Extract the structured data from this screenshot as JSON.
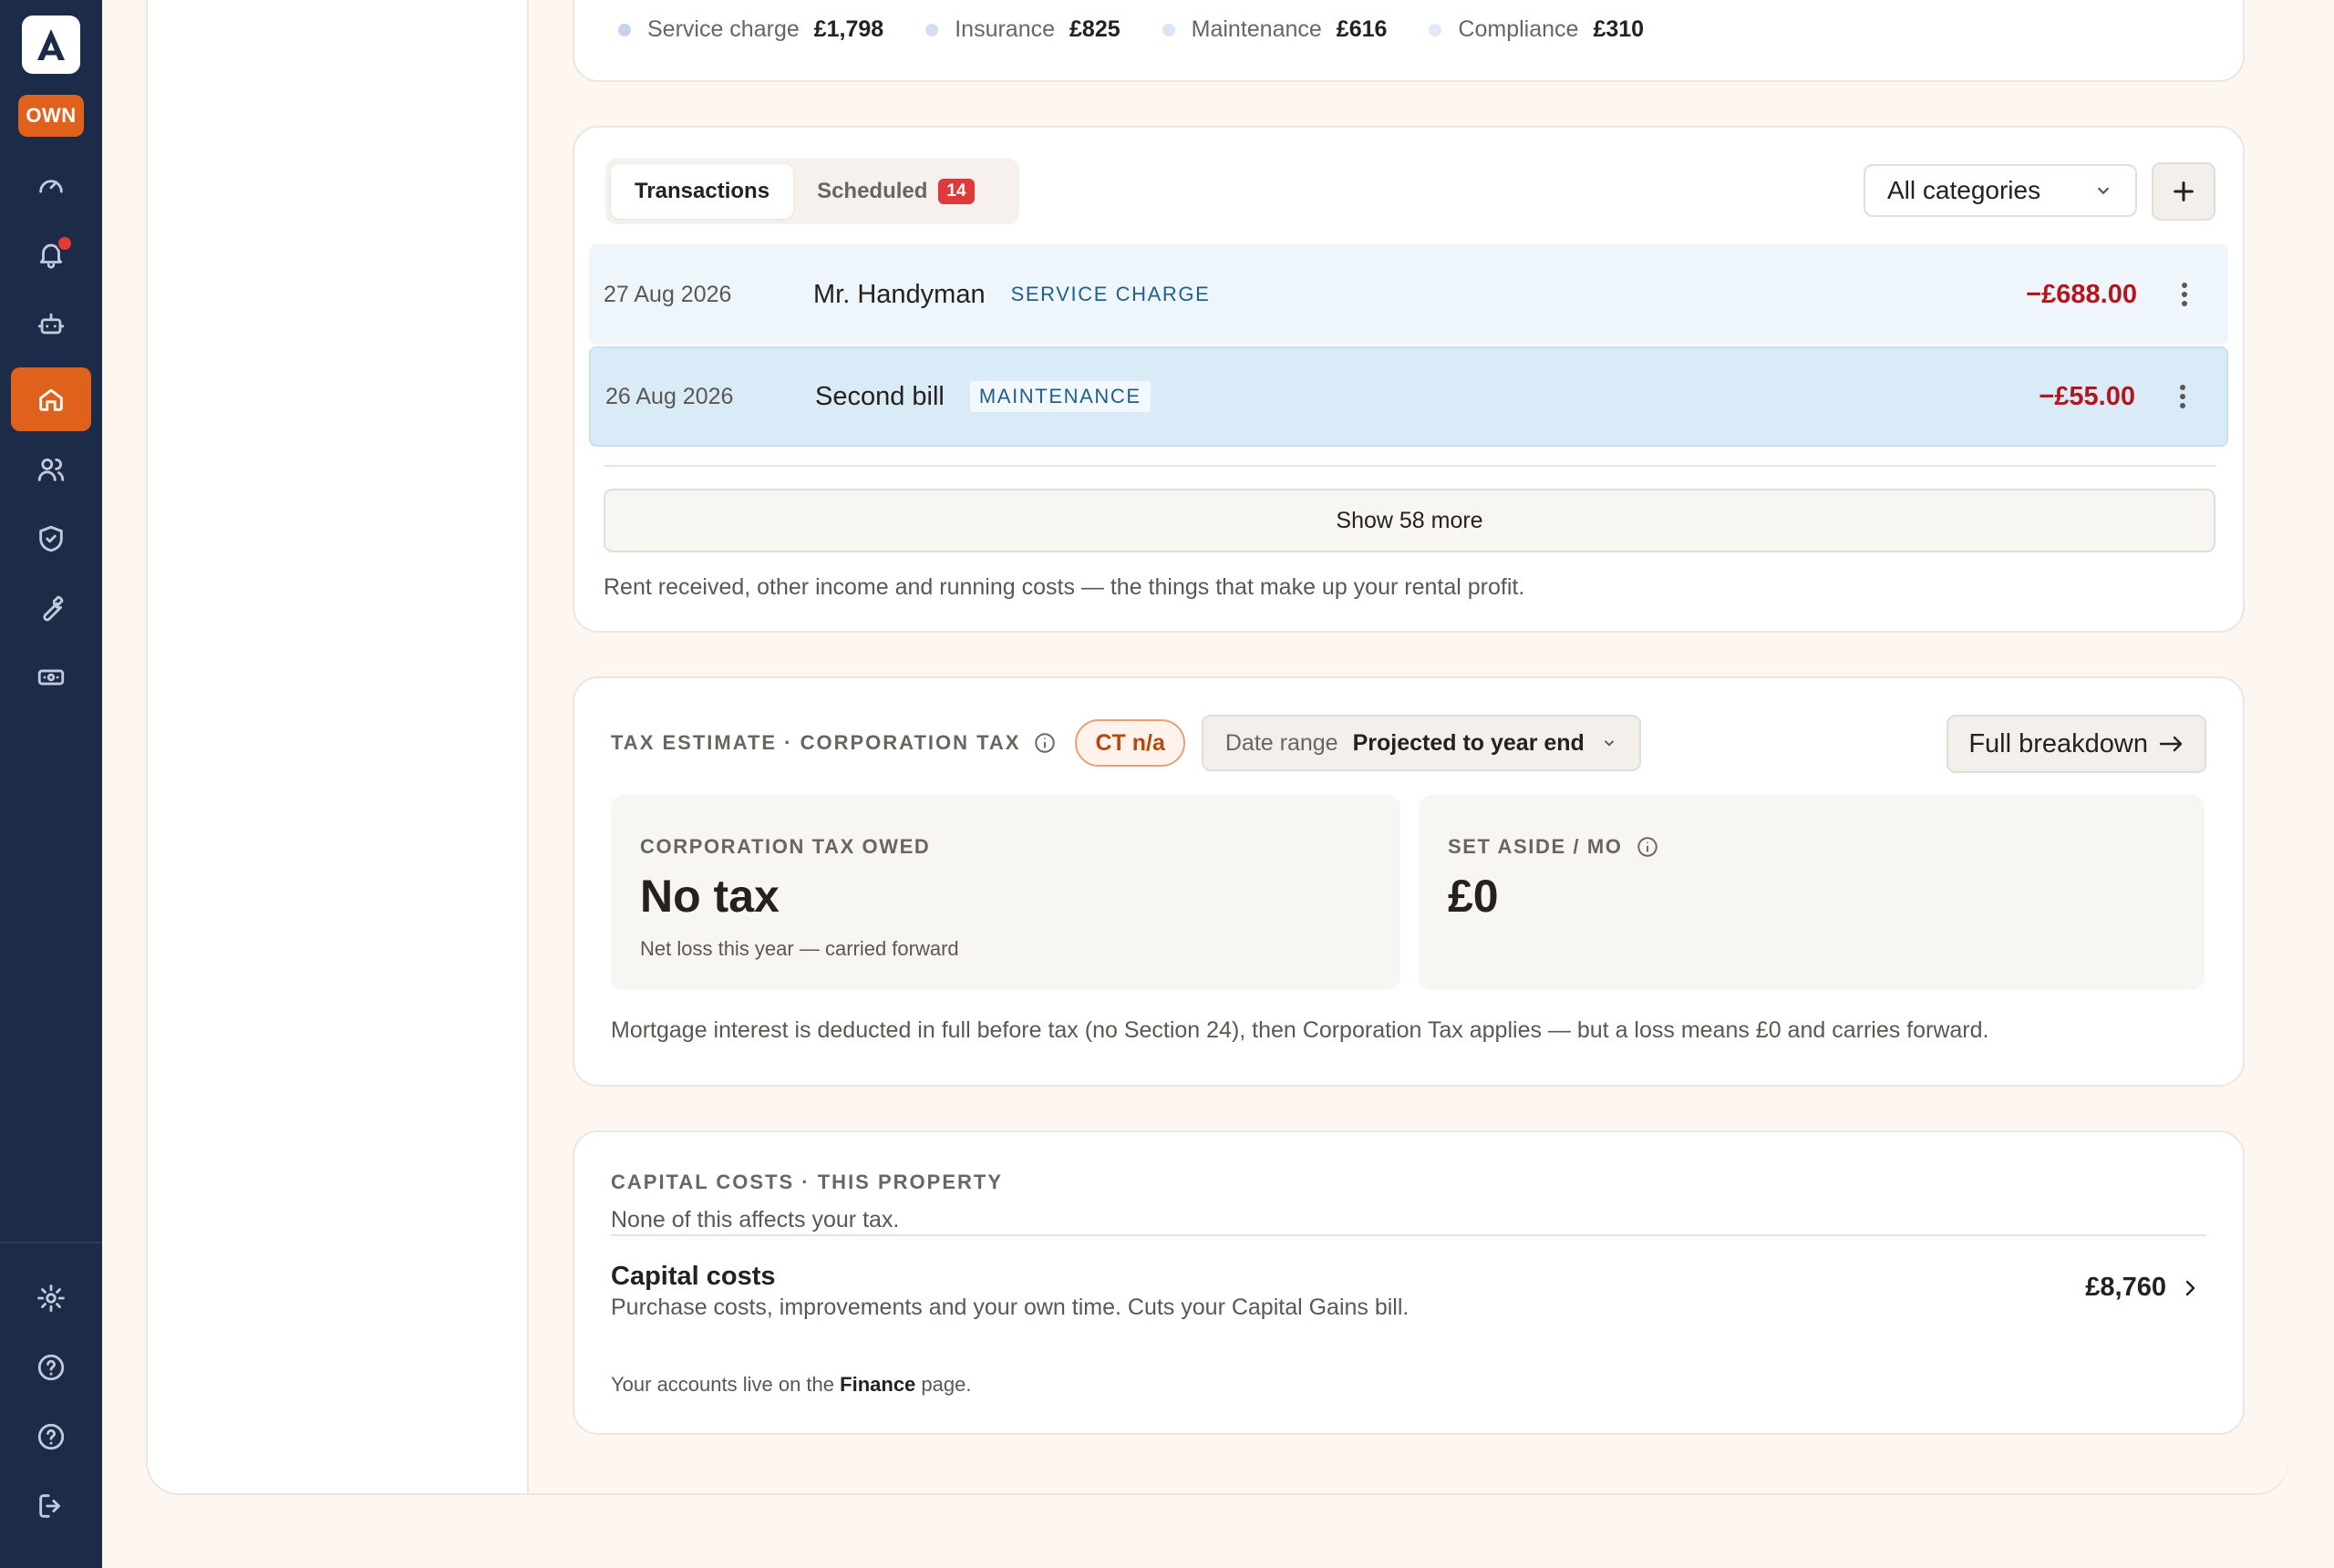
{
  "app": {
    "brand_badge": "OWN",
    "colors": {
      "accent": "#e0611c",
      "rail": "#1c2b48",
      "negative": "#b3161d",
      "tag": "#1f5f8b"
    }
  },
  "nav": {
    "items": [
      {
        "icon": "gauge-icon",
        "active": false
      },
      {
        "icon": "bell-icon",
        "active": false,
        "has_notification": true
      },
      {
        "icon": "bot-icon",
        "active": false
      },
      {
        "icon": "home-icon",
        "active": true
      },
      {
        "icon": "users-icon",
        "active": false
      },
      {
        "icon": "shield-check-icon",
        "active": false
      },
      {
        "icon": "wrench-icon",
        "active": false
      },
      {
        "icon": "banknote-icon",
        "active": false
      }
    ],
    "bottom": [
      {
        "icon": "settings-icon"
      },
      {
        "icon": "help-circle-icon"
      },
      {
        "icon": "help-circle-icon"
      },
      {
        "icon": "logout-icon"
      }
    ]
  },
  "summary": {
    "items": [
      {
        "label": "Service charge",
        "value": "£1,798",
        "color": "#c7d3e6"
      },
      {
        "label": "Insurance",
        "value": "£825",
        "color": "#d3def0"
      },
      {
        "label": "Maintenance",
        "value": "£616",
        "color": "#dbe5f3"
      },
      {
        "label": "Compliance",
        "value": "£310",
        "color": "#e1e9f5"
      }
    ]
  },
  "transactions": {
    "tabs": [
      {
        "label": "Transactions",
        "active": true
      },
      {
        "label": "Scheduled",
        "count": "14"
      }
    ],
    "category_filter": "All categories",
    "rows": [
      {
        "date": "27 Aug 2026",
        "payee": "Mr. Handyman",
        "tag": "SERVICE CHARGE",
        "amount": "−£688.00"
      },
      {
        "date": "26 Aug 2026",
        "payee": "Second bill",
        "tag": "MAINTENANCE",
        "amount": "−£55.00"
      }
    ],
    "show_more": "Show 58 more",
    "caption": "Rent received, other income and running costs — the things that make up your rental profit."
  },
  "tax": {
    "eyebrow": "TAX ESTIMATE · CORPORATION TAX",
    "ct_pill": "CT n/a",
    "date_range_label": "Date range",
    "date_range_value": "Projected to year end",
    "breakdown_button": "Full breakdown",
    "owed": {
      "label": "CORPORATION TAX OWED",
      "value": "No tax",
      "sub": "Net loss this year — carried forward"
    },
    "set_aside": {
      "label": "SET ASIDE / MO",
      "value": "£0"
    },
    "caption": "Mortgage interest is deducted in full before tax (no Section 24), then Corporation Tax applies — but a loss means £0 and carries forward."
  },
  "capital": {
    "eyebrow": "CAPITAL COSTS · THIS PROPERTY",
    "sub": "None of this affects your tax.",
    "title": "Capital costs",
    "description": "Purchase costs, improvements and your own time. Cuts your Capital Gains bill.",
    "amount": "£8,760",
    "footer_prefix": "Your accounts live on the",
    "footer_link": "Finance",
    "footer_suffix": "page."
  }
}
